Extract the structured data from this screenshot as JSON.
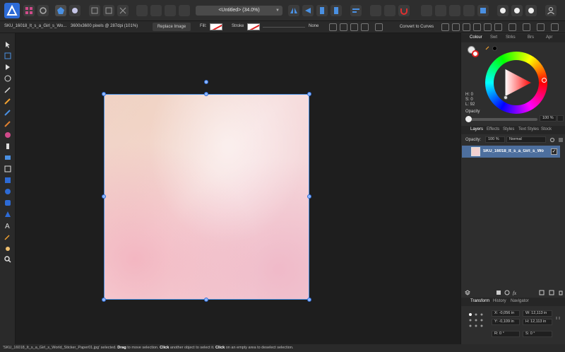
{
  "toolbar": {
    "document_title": "<Untitled> (34.0%)",
    "title_dropdown_icon": "chevron-down-icon"
  },
  "context_bar": {
    "file_name": "SKU_16018_It_s_a_Girl_s_Wo...",
    "image_info": "3600x3600 pixels @ 287dpi (101%)",
    "replace_image": "Replace Image",
    "fill_label": "Fill:",
    "stroke_label": "Stroke",
    "stroke_value": "None",
    "convert_to_curves": "Convert to Curves"
  },
  "colour_panel": {
    "tabs": [
      "Colour",
      "Swt",
      "Strks",
      "Brs",
      "Apr"
    ],
    "hsl": {
      "h": "H: 0",
      "s": "S: 0",
      "l": "L: 92"
    },
    "opacity_label": "Opacity",
    "opacity_value": "100 %"
  },
  "layers_panel": {
    "tabs": [
      "Layers",
      "Effects",
      "Styles",
      "Text Styles",
      "Stock"
    ],
    "opacity_label": "Opacity:",
    "opacity_value": "100 %",
    "blend_mode": "Normal",
    "layer_name": "SKU_16018_It_s_a_Girl_s_Wo",
    "layer_visible": "✓"
  },
  "transform_panel": {
    "tabs": [
      "Transform",
      "History",
      "Navigator"
    ],
    "x": "X: -0,056 in",
    "y": "Y: -0,109 in",
    "w": "W: 12,113 in",
    "h": "H: 12,113 in",
    "r": "R: 0 °",
    "s": "S: 0 °"
  },
  "status_bar": {
    "prefix": "'SKU_16018_It_s_a_Girl_s_World_Sticker_Paper01.jpg' selected.",
    "drag": "Drag",
    "drag_text": "to move selection.",
    "click": "Click",
    "click_text": "another object to select it.",
    "click2": "Click",
    "click2_text": "on an empty area to deselect selection."
  },
  "colors": {
    "accent": "#2d6bd6",
    "selection": "#4a90e2",
    "layer_highlight": "#4d6f9e"
  }
}
